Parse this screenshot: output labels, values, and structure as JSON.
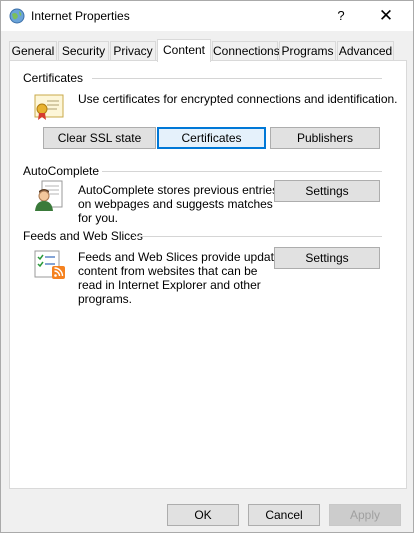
{
  "window": {
    "title": "Internet Properties",
    "help_glyph": "?",
    "close_glyph": "✕"
  },
  "tabs": [
    {
      "label": "General"
    },
    {
      "label": "Security"
    },
    {
      "label": "Privacy"
    },
    {
      "label": "Content",
      "active": true
    },
    {
      "label": "Connections"
    },
    {
      "label": "Programs"
    },
    {
      "label": "Advanced"
    }
  ],
  "certificates": {
    "heading": "Certificates",
    "description": "Use certificates for encrypted connections and identification.",
    "clear_ssl_label": "Clear SSL state",
    "certificates_label": "Certificates",
    "publishers_label": "Publishers"
  },
  "autocomplete": {
    "heading": "AutoComplete",
    "description_lines": [
      "AutoComplete stores previous entries",
      "on webpages and suggests matches",
      "for you."
    ],
    "settings_label": "Settings"
  },
  "feeds": {
    "heading": "Feeds and Web Slices",
    "description_lines": [
      "Feeds and Web Slices provide updated",
      "content from websites that can be",
      "read in Internet Explorer and other",
      "programs."
    ],
    "settings_label": "Settings"
  },
  "footer": {
    "ok_label": "OK",
    "cancel_label": "Cancel",
    "apply_label": "Apply"
  },
  "colors": {
    "accent": "#0078d7",
    "rss_orange": "#f58220"
  }
}
